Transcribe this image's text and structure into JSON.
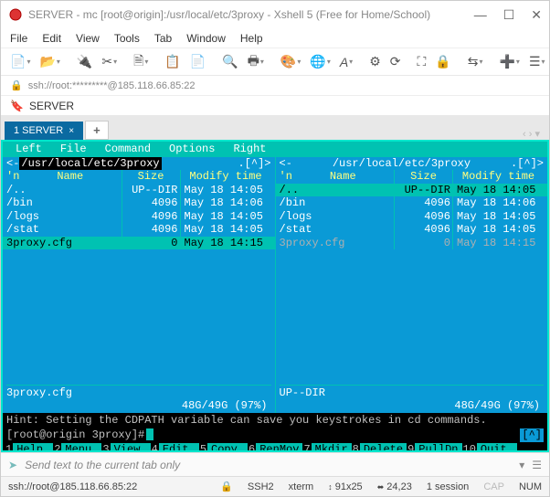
{
  "titlebar": {
    "title": "SERVER - mc [root@origin]:/usr/local/etc/3proxy - Xshell 5 (Free for Home/School)"
  },
  "menubar": [
    "File",
    "Edit",
    "View",
    "Tools",
    "Tab",
    "Window",
    "Help"
  ],
  "addrbar": {
    "text": "ssh://root:*********@185.118.66.85:22"
  },
  "tabbar": {
    "label": "SERVER"
  },
  "sessiontab": {
    "label": "1 SERVER",
    "close": "×",
    "add": "+",
    "arrows": "‹ › ▾"
  },
  "mcmenu": {
    "left": "Left",
    "file": "File",
    "command": "Command",
    "options": "Options",
    "right": "Right"
  },
  "panel_left": {
    "path": "/usr/local/etc/3proxy",
    "corner_l": "<-",
    "corner_r": ".[^]>",
    "cols": {
      "n": "'n",
      "name": "Name",
      "size": "Size",
      "mtime": "Modify time"
    },
    "rows": [
      {
        "name": "/..",
        "size": "UP--DIR",
        "time": "May 18 14:05"
      },
      {
        "name": "/bin",
        "size": "4096",
        "time": "May 18 14:06"
      },
      {
        "name": "/logs",
        "size": "4096",
        "time": "May 18 14:05"
      },
      {
        "name": "/stat",
        "size": "4096",
        "time": "May 18 14:05"
      },
      {
        "name": " 3proxy.cfg",
        "size": "0",
        "time": "May 18 14:15"
      }
    ],
    "footer": "3proxy.cfg",
    "usage": "48G/49G (97%)"
  },
  "panel_right": {
    "path": "/usr/local/etc/3proxy",
    "corner_l": "<-",
    "corner_r": ".[^]>",
    "cols": {
      "n": "'n",
      "name": "Name",
      "size": "Size",
      "mtime": "Modify time"
    },
    "rows": [
      {
        "name": "/..",
        "size": "UP--DIR",
        "time": "May 18 14:05"
      },
      {
        "name": "/bin",
        "size": "4096",
        "time": "May 18 14:06"
      },
      {
        "name": "/logs",
        "size": "4096",
        "time": "May 18 14:05"
      },
      {
        "name": "/stat",
        "size": "4096",
        "time": "May 18 14:05"
      },
      {
        "name": " 3proxy.cfg",
        "size": "0",
        "time": "May 18 14:15"
      }
    ],
    "footer": "UP--DIR",
    "usage": "48G/49G (97%)"
  },
  "hint": "Hint: Setting the CDPATH variable can save you keystrokes in cd commands.",
  "prompt": "[root@origin 3proxy]#",
  "prompt_ind": "[^]",
  "fkeys": [
    {
      "n": "1",
      "l": "Help"
    },
    {
      "n": "2",
      "l": "Menu"
    },
    {
      "n": "3",
      "l": "View"
    },
    {
      "n": "4",
      "l": "Edit"
    },
    {
      "n": "5",
      "l": "Copy"
    },
    {
      "n": "6",
      "l": "RenMov"
    },
    {
      "n": "7",
      "l": "Mkdir"
    },
    {
      "n": "8",
      "l": "Delete"
    },
    {
      "n": "9",
      "l": "PullDn"
    },
    {
      "n": "10",
      "l": "Quit"
    }
  ],
  "inputbar": {
    "placeholder": "Send text to the current tab only"
  },
  "statusbar": {
    "conn": "ssh://root@185.118.66.85:22",
    "ssh": "SSH2",
    "term": "xterm",
    "size": "91x25",
    "cursor": "24,23",
    "sess": "1 session",
    "caps": "CAP",
    "num": "NUM"
  }
}
